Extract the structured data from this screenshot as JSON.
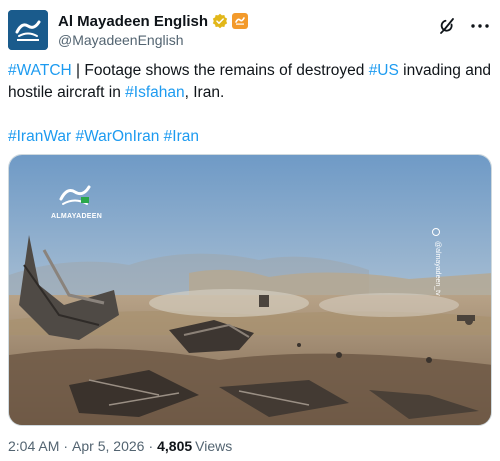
{
  "author": {
    "display_name": "Al Mayadeen English",
    "handle": "@MayadeenEnglish",
    "avatar_icon": "al-mayadeen-logo",
    "verified_icon": "verified-gold-badge",
    "affiliate_icon": "affiliate-badge"
  },
  "actions": {
    "grok_icon": "grok-icon",
    "more_icon": "more-options-icon"
  },
  "tweet": {
    "line1": {
      "tag1": "#WATCH",
      "text1": " | Footage shows the remains of destroyed ",
      "tag2": "#US",
      "text2": " invading and hostile aircraft in ",
      "tag3": "#Isfahan",
      "text3": ", Iran."
    },
    "hashtags": [
      "#IranWar",
      "#WarOnIran",
      "#Iran"
    ]
  },
  "media": {
    "watermark": "ALMAYADEEN",
    "side_handle": "@almayadeen_tv"
  },
  "meta": {
    "time": "2:04 AM",
    "date": "Apr 5, 2026",
    "views_count": "4,805",
    "views_label": "Views",
    "separator": "·"
  },
  "colors": {
    "link": "#1d9bf0",
    "text": "#0f1419",
    "muted": "#536471",
    "verified_gold": "#e2b719",
    "avatar_bg": "#1a5b8c"
  }
}
